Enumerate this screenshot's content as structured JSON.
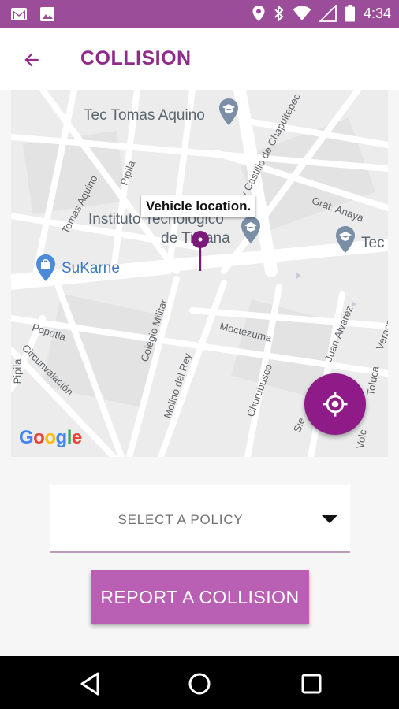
{
  "status_bar": {
    "time": "4:34",
    "icons": [
      "gmail-icon",
      "image-icon",
      "location-icon",
      "bluetooth-icon",
      "wifi-icon",
      "signal-icon",
      "battery-icon"
    ]
  },
  "app_bar": {
    "title": "COLLISION",
    "back_icon": "arrow-left-icon"
  },
  "map": {
    "tooltip": "Vehicle location.",
    "places": {
      "tec_tomas": "Tec Tomas Aquino",
      "instituto_1": "Instituto Tecnológico",
      "instituto_2": "de Tijuana",
      "sukarne": "SuKarne",
      "tec_right": "Tec"
    },
    "streets": {
      "tomas_aquino": "Tomas Aquino",
      "pipila": "Pipila",
      "castillo": "Av Castillo de Chapultepec",
      "grat_anaya": "Grat. Anaya",
      "popotla": "Popotla",
      "circunvalacion": "Circunvalación",
      "colegio_militar": "Colegio Militar",
      "moctezuma": "Moctezuma",
      "juan_alvarez": "Juan Álvarez",
      "molino_del_rey": "Molino del Rey",
      "churubusco": "Churubusco",
      "toluca": "Toluca",
      "veracruz": "Veracruz",
      "pipila_left": "Pipila",
      "sie": "Sie",
      "volc": "Volc"
    },
    "google_logo": "Google",
    "locate_icon": "my-location-icon",
    "brand_color": "#8e1b88"
  },
  "policy": {
    "label": "SELECT A POLICY",
    "arrow_icon": "dropdown-arrow-icon"
  },
  "report_button": {
    "label": "REPORT A COLLISION",
    "color": "#b960b5"
  },
  "nav_bar": {
    "icons": [
      "back-triangle-icon",
      "home-circle-icon",
      "recents-square-icon"
    ]
  }
}
